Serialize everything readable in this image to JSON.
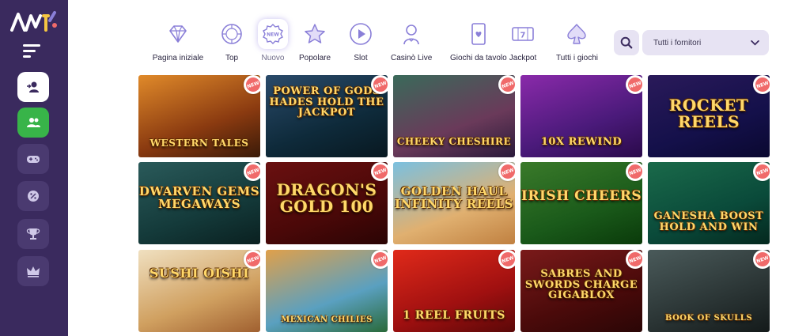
{
  "sidebar": {
    "logo_icon": "casino-logo",
    "menu_icon": "hamburger-menu-icon",
    "buttons": [
      {
        "icon": "login-user-icon"
      },
      {
        "icon": "register-users-icon"
      },
      {
        "icon": "gamepad-icon"
      },
      {
        "icon": "bonus-wheel-icon"
      },
      {
        "icon": "trophy-icon"
      },
      {
        "icon": "crown-icon"
      }
    ]
  },
  "nav": {
    "items": [
      {
        "label": "Pagina iniziale",
        "icon": "diamond-icon"
      },
      {
        "label": "Top",
        "icon": "top-badge-icon"
      },
      {
        "label": "Nuovo",
        "icon": "new-badge-icon",
        "active": true
      },
      {
        "label": "Popolare",
        "icon": "star-icon"
      },
      {
        "label": "Slot",
        "icon": "play-icon"
      },
      {
        "label": "Casinò Live",
        "icon": "dealer-icon"
      },
      {
        "label": "Giochi da tavolo",
        "icon": "playing-card-icon"
      },
      {
        "label": "Jackpot",
        "icon": "jackpot-777-icon"
      },
      {
        "label": "Tutti i giochi",
        "icon": "spade-icon"
      }
    ]
  },
  "search": {
    "icon": "search-icon"
  },
  "provider_filter": {
    "value": "Tutti i fornitori",
    "icon": "chevron-down-icon"
  },
  "colors": {
    "sidebar_bg": "#3a2a5e",
    "accent": "#8a7fd8",
    "register_green": "#38b449",
    "badge_red": "#f06a6a"
  },
  "badge_text": "NEW",
  "games": [
    {
      "title": "WESTERN TALES",
      "bg": "linear-gradient(160deg,#e08a2a,#8a3a10 60%,#3a1a08)"
    },
    {
      "title": "POWER OF GODS HADES HOLD THE JACKPOT",
      "bg": "linear-gradient(160deg,#2a4a6a,#0e2a3a 60%,#081820)"
    },
    {
      "title": "CHEEKY CHESHIRE",
      "bg": "linear-gradient(160deg,#3a6a5a,#6a3a5a 60%,#2a1a3a)"
    },
    {
      "title": "10X REWIND",
      "bg": "linear-gradient(160deg,#8a2aaa,#4a1a7a 60%,#2a0a4a)"
    },
    {
      "title": "ROCKET REELS",
      "bg": "linear-gradient(160deg,#2a1a5a,#14104a 60%,#0a0830)"
    },
    {
      "title": "DWARVEN GEMS MEGAWAYS",
      "bg": "linear-gradient(160deg,#2a5a5a,#143a3a 60%,#0a2020)"
    },
    {
      "title": "DRAGON'S GOLD 100",
      "bg": "linear-gradient(160deg,#6a1010,#4a0808 60%,#2a0404)"
    },
    {
      "title": "GOLDEN HAUL INFINITY REELS",
      "bg": "linear-gradient(160deg,#7ac0e0,#e0b070 60%,#c08040)"
    },
    {
      "title": "IRISH CHEERS",
      "bg": "linear-gradient(160deg,#3a7a2a,#1a5a1a 60%,#0a3a0a)"
    },
    {
      "title": "GANESHA BOOST HOLD AND WIN",
      "bg": "linear-gradient(160deg,#1a6a4a,#0a4a3a 60%,#04281e)"
    },
    {
      "title": "SUSHI OISHI",
      "bg": "linear-gradient(160deg,#f0e0c0,#d0a060 60%,#a06030)"
    },
    {
      "title": "MEXICAN CHILIES",
      "bg": "linear-gradient(160deg,#e0a04a,#5aa0c0 60%,#2a6a3a)"
    },
    {
      "title": "1 REEL FRUITS",
      "bg": "linear-gradient(160deg,#e02a1a,#a01010 60%,#5a0808)"
    },
    {
      "title": "SABRES AND SWORDS CHARGE GIGABLOX",
      "bg": "linear-gradient(160deg,#7a1a1a,#4a0a0a 60%,#2a0606)"
    },
    {
      "title": "BOOK OF SKULLS",
      "bg": "linear-gradient(160deg,#4a5a5a,#2a3434 60%,#141a1a)"
    }
  ]
}
